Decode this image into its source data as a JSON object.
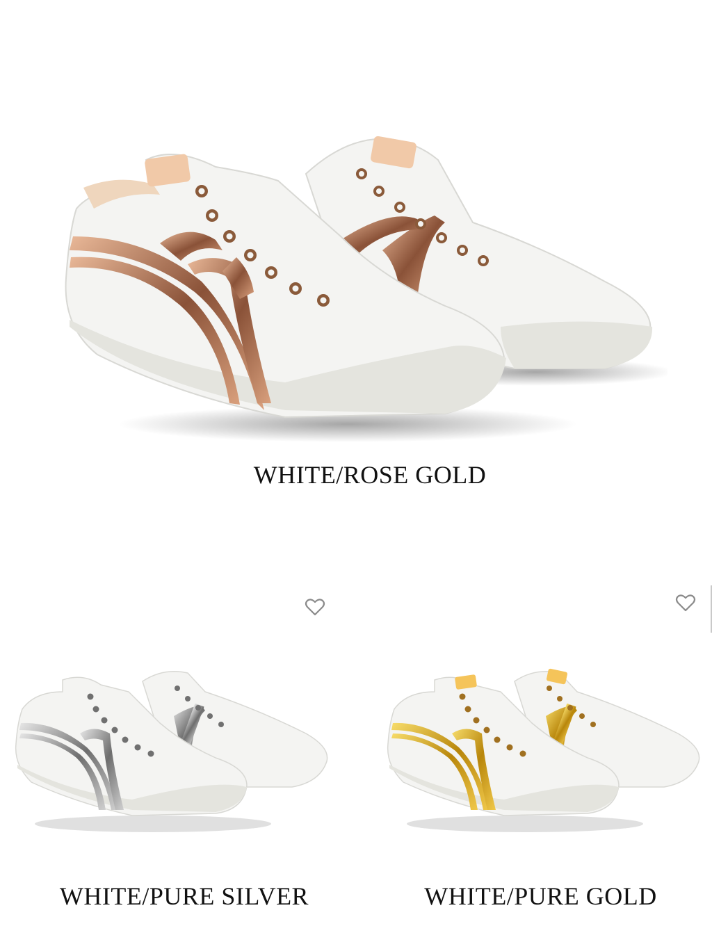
{
  "products": [
    {
      "caption": "WHITE/ROSE GOLD",
      "stripe_color": "#b8785a",
      "stripe_highlight": "#efc3a4",
      "eyelet_color": "#8a5a3a",
      "heel_tab_color": "#f1c9a8"
    },
    {
      "caption": "WHITE/PURE SILVER",
      "stripe_color": "#7d7d7d",
      "stripe_highlight": "#e2e2e2",
      "eyelet_color": "#707070",
      "heel_tab_color": "#e6e6e6",
      "favorite_icon": "heart-outline-icon"
    },
    {
      "caption": "WHITE/PURE GOLD",
      "stripe_color": "#c8961e",
      "stripe_highlight": "#f7dc6a",
      "eyelet_color": "#a07020",
      "heel_tab_color": "#f5c45a",
      "favorite_icon": "heart-outline-icon"
    }
  ],
  "colors": {
    "background": "#ffffff",
    "caption_text": "#111111",
    "canvas_upper": "#f2f2f0",
    "midsole": "#e2e2dc",
    "heart_outline": "#8a8a8a"
  }
}
